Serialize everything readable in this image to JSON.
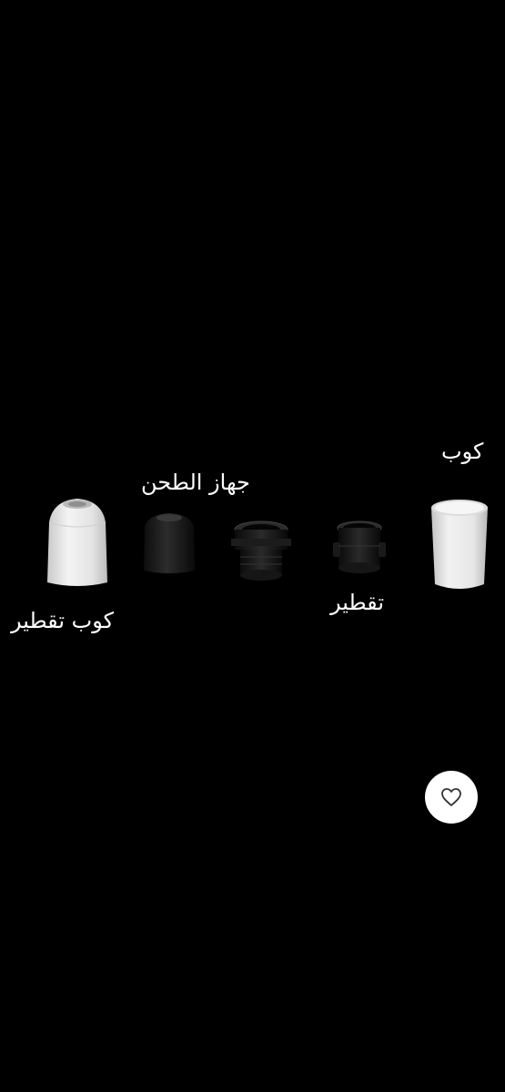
{
  "labels": {
    "cup": "كوب",
    "grinder": "جهاز الطحن",
    "drip": "تقطير",
    "drip_cup": "كوب تقطير"
  },
  "parts": [
    {
      "name": "drip-cup",
      "color": "#e2e2e2",
      "icon": "dome-cup-icon"
    },
    {
      "name": "grinder-cap",
      "color": "#1b1b1b",
      "icon": "dome-cap-icon"
    },
    {
      "name": "grinder-body",
      "color": "#1e1e1e",
      "icon": "threaded-ring-icon"
    },
    {
      "name": "drip-filter",
      "color": "#1e1e1e",
      "icon": "threaded-filter-icon"
    },
    {
      "name": "cup",
      "color": "#e6e6e6",
      "icon": "cylinder-cup-icon"
    }
  ],
  "favorite": {
    "icon": "heart-icon",
    "background": "#ffffff",
    "icon_color": "#333333"
  }
}
